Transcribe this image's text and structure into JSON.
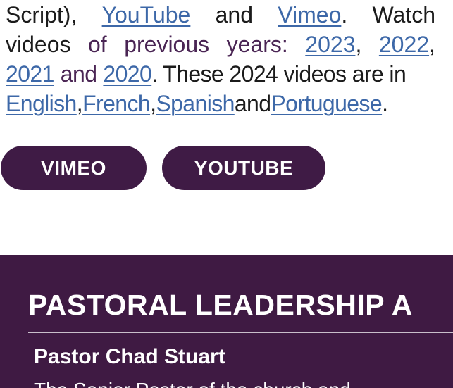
{
  "intro": {
    "line1": {
      "w1": "Script),",
      "link_youtube": "YouTube",
      "w2": "and",
      "link_vimeo": "Vimeo",
      "w3": ".",
      "w4": "Watch"
    },
    "line2": {
      "w1": "videos",
      "w2": "of",
      "w3": "previous",
      "w4": "years:",
      "link_2023": "2023",
      "comma1": ",",
      "link_2022": "2022",
      "comma2": ","
    },
    "line3": {
      "link_2021": "2021",
      "w1": "and",
      "link_2020": "2020",
      "w2": ". These 2024 videos are in"
    },
    "line4": {
      "link_english": "English",
      "comma1": ",",
      "link_french": "French",
      "comma2": ",",
      "link_spanish": "Spanish",
      "w1": "and",
      "link_portuguese": "Portuguese",
      "period": "."
    }
  },
  "buttons": {
    "vimeo": "VIMEO",
    "youtube": "YOUTUBE"
  },
  "footer": {
    "title": "PASTORAL LEADERSHIP A",
    "name": "Pastor Chad Stuart",
    "next_line": "The Senior Pastor of the church and"
  },
  "colors": {
    "link": "#3d68a8",
    "brand_purple": "#3f1b45",
    "footer_bg": "#3f1a43",
    "text": "#1b1b1b"
  }
}
